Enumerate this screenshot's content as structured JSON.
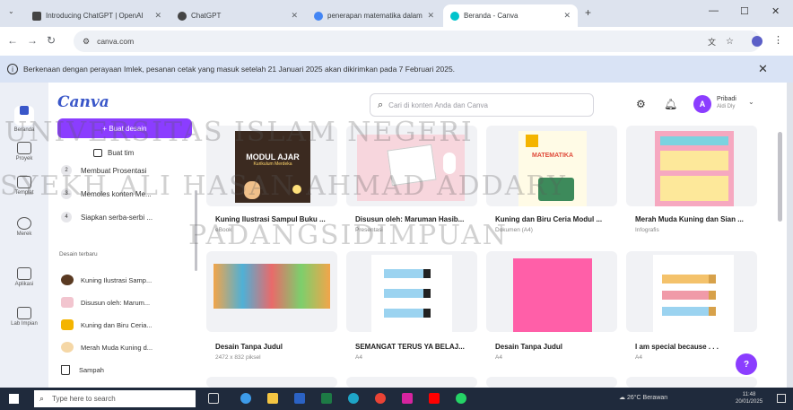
{
  "browser": {
    "tabs": [
      {
        "label": "Introducing ChatGPT | OpenAI",
        "active": false,
        "color": "#444444"
      },
      {
        "label": "ChatGPT",
        "active": false,
        "color": "#444444"
      },
      {
        "label": "penerapan matematika dalam",
        "active": false,
        "color": "#4285f4"
      },
      {
        "label": "Beranda - Canva",
        "active": true,
        "color": "#00c4cc"
      }
    ],
    "new_tab": "+",
    "url": "canva.com",
    "banner": "Berkenaan dengan perayaan Imlek, pesanan cetak yang masuk setelah 21 Januari 2025 akan dikirimkan pada 7 Februari 2025."
  },
  "rail": [
    {
      "label": "Beranda"
    },
    {
      "label": "Proyek"
    },
    {
      "label": "Templat"
    },
    {
      "label": "Merek"
    },
    {
      "label": "Aplikasi"
    },
    {
      "label": "Lab Impian"
    }
  ],
  "panel": {
    "logo": "Canva",
    "create_label": "+ Buat desain",
    "team_label": "Buat tim",
    "steps": [
      {
        "num": "2",
        "label": "Membuat Prosentasi"
      },
      {
        "num": "3",
        "label": "Memoles konten Me..."
      },
      {
        "num": "4",
        "label": "Siapkan serba-serbi ..."
      }
    ],
    "recent_heading": "Desain terbaru",
    "recent": [
      {
        "label": "Kuning Ilustrasi Samp...",
        "color": "#5a3a22"
      },
      {
        "label": "Disusun oleh: Marum...",
        "color": "#f2c5cf"
      },
      {
        "label": "Kuning dan Biru Ceria...",
        "color": "#f4b400"
      },
      {
        "label": "Merah Muda Kuning d...",
        "color": "#f5d7a6"
      }
    ],
    "trash_label": "Sampah"
  },
  "main": {
    "search_placeholder": "Cari di konten Anda dan Canva",
    "account_name": "Pribadi",
    "account_sub": "Aldi Dly",
    "avatar_letter": "A",
    "cards_row1": [
      {
        "title": "Kuning Ilustrasi Sampul Buku ...",
        "sub": "eBook",
        "thumb_text": "MODUL AJAR",
        "thumb_sub": "Kurikulum Merdeka"
      },
      {
        "title": "Disusun oleh: Maruman Hasib...",
        "sub": "Presentasi",
        "thumb_text": "",
        "thumb_sub": ""
      },
      {
        "title": "Kuning dan Biru Ceria Modul ...",
        "sub": "Dokumen (A4)",
        "thumb_text": "MATEMATIKA",
        "thumb_sub": ""
      },
      {
        "title": "Merah Muda Kuning dan Sian ...",
        "sub": "Infografis",
        "thumb_text": "",
        "thumb_sub": ""
      }
    ],
    "cards_row2": [
      {
        "title": "Desain Tanpa Judul",
        "sub": "2472 x 832 piksel"
      },
      {
        "title": "SEMANGAT TERUS YA BELAJ...",
        "sub": "A4"
      },
      {
        "title": "Desain Tanpa Judul",
        "sub": "A4"
      },
      {
        "title": "I am special because . . .",
        "sub": "A4"
      }
    ],
    "help_label": "?"
  },
  "taskbar": {
    "search_placeholder": "Type here to search",
    "weather": "26°C Berawan",
    "time": "11:48",
    "date": "20/01/2025"
  },
  "watermark": {
    "line1": "UNIVERSITAS ISLAM NEGERI",
    "line2": "SYEKH ALI HASAN AHMAD ADDARY",
    "line3": "PADANGSIDIMPUAN"
  }
}
